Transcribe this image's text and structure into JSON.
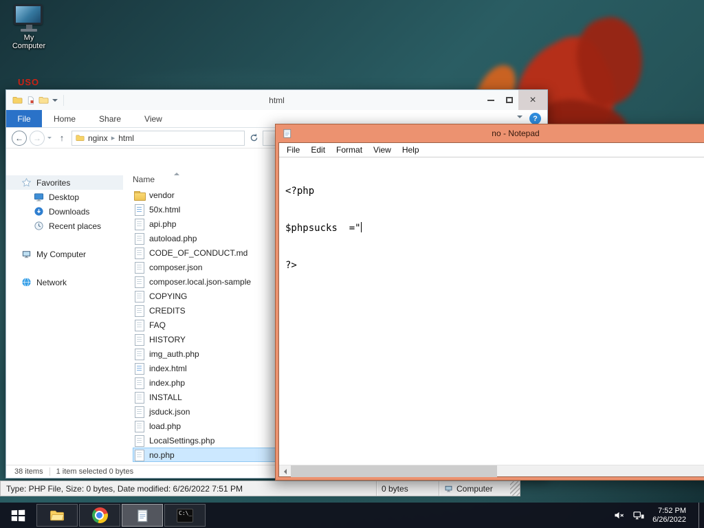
{
  "desktop": {
    "my_computer_label": "My Computer",
    "artifact_text": "USO"
  },
  "explorer": {
    "title": "html",
    "file_tab": "File",
    "tabs": [
      "Home",
      "Share",
      "View"
    ],
    "breadcrumb": {
      "root": "nginx",
      "current": "html"
    },
    "sidebar": {
      "favorites_label": "Favorites",
      "favorites_items": [
        "Desktop",
        "Downloads",
        "Recent places"
      ],
      "computer_label": "My Computer",
      "network_label": "Network"
    },
    "list": {
      "header": "Name"
    },
    "files": [
      {
        "name": "vendor",
        "kind": "folder"
      },
      {
        "name": "50x.html",
        "kind": "html"
      },
      {
        "name": "api.php",
        "kind": "file"
      },
      {
        "name": "autoload.php",
        "kind": "file"
      },
      {
        "name": "CODE_OF_CONDUCT.md",
        "kind": "file"
      },
      {
        "name": "composer.json",
        "kind": "file"
      },
      {
        "name": "composer.local.json-sample",
        "kind": "file"
      },
      {
        "name": "COPYING",
        "kind": "file"
      },
      {
        "name": "CREDITS",
        "kind": "file"
      },
      {
        "name": "FAQ",
        "kind": "file"
      },
      {
        "name": "HISTORY",
        "kind": "file"
      },
      {
        "name": "img_auth.php",
        "kind": "file"
      },
      {
        "name": "index.html",
        "kind": "html"
      },
      {
        "name": "index.php",
        "kind": "file"
      },
      {
        "name": "INSTALL",
        "kind": "file"
      },
      {
        "name": "jsduck.json",
        "kind": "file"
      },
      {
        "name": "load.php",
        "kind": "file"
      },
      {
        "name": "LocalSettings.php",
        "kind": "file"
      },
      {
        "name": "no.php",
        "kind": "file"
      }
    ],
    "status": {
      "items": "38 items",
      "selection": "1 item selected 0 bytes"
    },
    "details": {
      "info": "Type: PHP File, Size: 0 bytes, Date modified: 6/26/2022 7:51 PM",
      "size": "0 bytes",
      "location": "Computer"
    }
  },
  "notepad": {
    "title": "no - Notepad",
    "menus": [
      "File",
      "Edit",
      "Format",
      "View",
      "Help"
    ],
    "lines": [
      "<?php",
      "$phpsucks  =\"",
      "?>"
    ]
  },
  "taskbar": {
    "time": "7:52 PM",
    "date": "6/26/2022"
  },
  "colors": {
    "notepad_accent": "#ec9270",
    "file_tab_blue": "#2a72c8",
    "selection_blue": "#cce8ff"
  }
}
